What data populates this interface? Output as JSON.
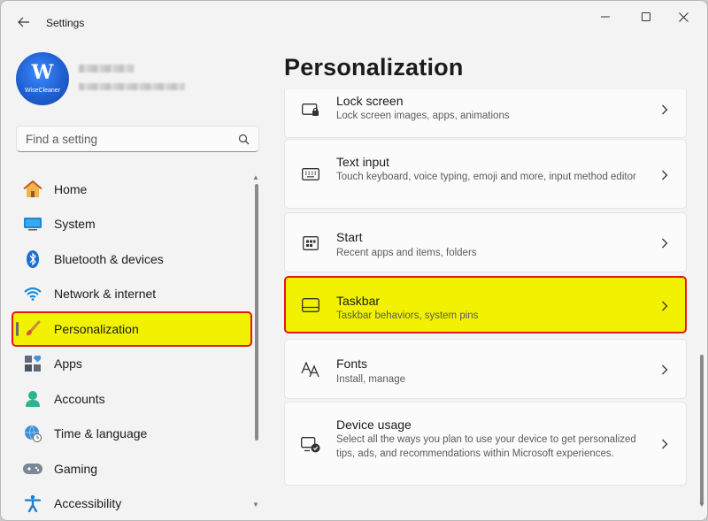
{
  "window": {
    "title": "Settings"
  },
  "profile": {
    "avatar_letter": "W",
    "avatar_brand": "WiseCleaner"
  },
  "search": {
    "placeholder": "Find a setting"
  },
  "sidebar": {
    "items": [
      {
        "label": "Home",
        "icon": "home-icon"
      },
      {
        "label": "System",
        "icon": "system-icon"
      },
      {
        "label": "Bluetooth & devices",
        "icon": "bluetooth-icon"
      },
      {
        "label": "Network & internet",
        "icon": "wifi-icon"
      },
      {
        "label": "Personalization",
        "icon": "brush-icon",
        "active": true
      },
      {
        "label": "Apps",
        "icon": "apps-icon"
      },
      {
        "label": "Accounts",
        "icon": "account-icon"
      },
      {
        "label": "Time & language",
        "icon": "globe-clock-icon"
      },
      {
        "label": "Gaming",
        "icon": "gamepad-icon"
      },
      {
        "label": "Accessibility",
        "icon": "accessibility-icon"
      }
    ]
  },
  "main": {
    "title": "Personalization",
    "cards": [
      {
        "title": "Lock screen",
        "desc": "Lock screen images, apps, animations",
        "icon": "lock-screen-icon"
      },
      {
        "title": "Text input",
        "desc": "Touch keyboard, voice typing, emoji and more, input method editor",
        "icon": "keyboard-icon"
      },
      {
        "title": "Start",
        "desc": "Recent apps and items, folders",
        "icon": "start-icon"
      },
      {
        "title": "Taskbar",
        "desc": "Taskbar behaviors, system pins",
        "icon": "taskbar-icon",
        "highlighted": true
      },
      {
        "title": "Fonts",
        "desc": "Install, manage",
        "icon": "fonts-icon"
      },
      {
        "title": "Device usage",
        "desc": "Select all the ways you plan to use your device to get personalized tips, ads, and recommendations within Microsoft experiences.",
        "icon": "device-usage-icon"
      }
    ]
  },
  "colors": {
    "highlight": "#f2f200",
    "highlight_border": "#e01a1a",
    "accent": "#0067c0"
  }
}
